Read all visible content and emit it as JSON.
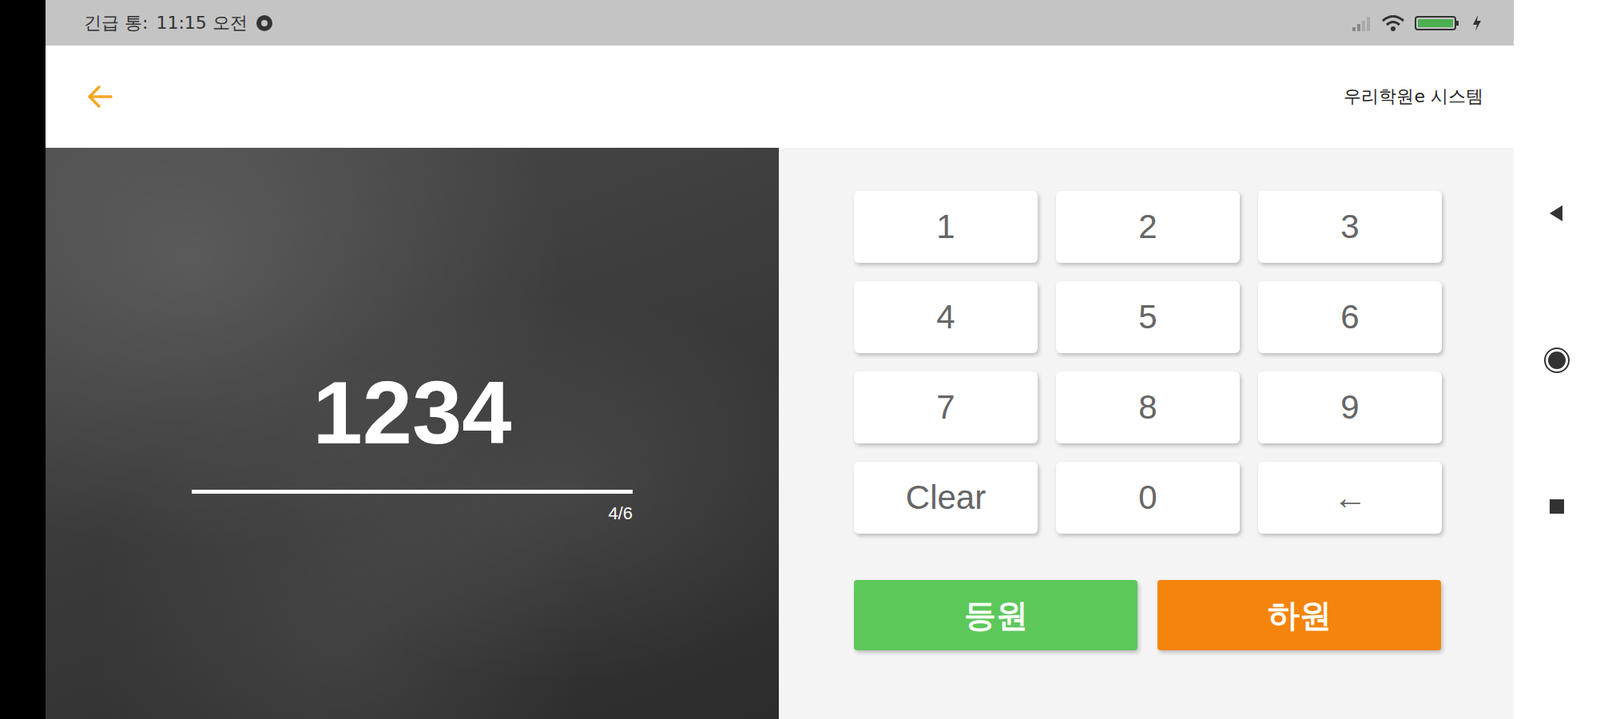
{
  "status_bar": {
    "carrier": "긴급 통:",
    "time": "11:15 오전"
  },
  "header": {
    "title": "우리학원e 시스템"
  },
  "display": {
    "value": "1234",
    "count": "4/6"
  },
  "keypad": [
    {
      "label": "1"
    },
    {
      "label": "2"
    },
    {
      "label": "3"
    },
    {
      "label": "4"
    },
    {
      "label": "5"
    },
    {
      "label": "6"
    },
    {
      "label": "7"
    },
    {
      "label": "8"
    },
    {
      "label": "9"
    },
    {
      "label": "Clear"
    },
    {
      "label": "0"
    },
    {
      "label": "←"
    }
  ],
  "actions": [
    {
      "label": "등원",
      "color": "#5cc85a"
    },
    {
      "label": "하원",
      "color": "#f5840c"
    }
  ]
}
